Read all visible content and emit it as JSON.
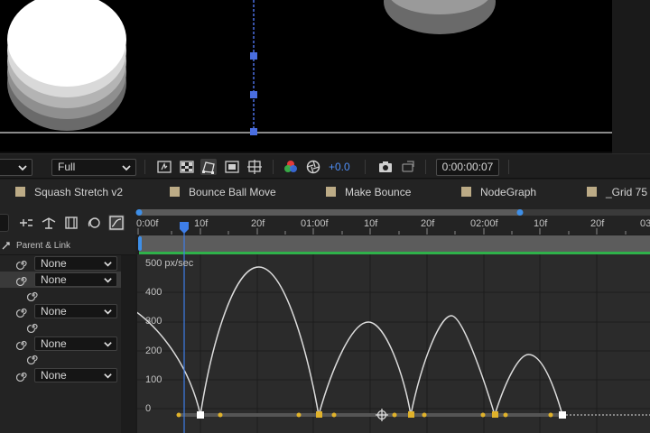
{
  "toolbar": {
    "resolution": "Full",
    "exposure": "+0.0",
    "timecode": "0:00:00:07"
  },
  "tabs": [
    {
      "label": "Squash Stretch v2"
    },
    {
      "label": "Bounce Ball Move"
    },
    {
      "label": "Make Bounce"
    },
    {
      "label": "NodeGraph"
    },
    {
      "label": "_Grid 75"
    }
  ],
  "timeline": {
    "header_label": "Parent & Link",
    "parent_rows": [
      {
        "value": "None"
      },
      {
        "value": "None"
      },
      {
        "value": "None"
      },
      {
        "value": "None"
      },
      {
        "value": "None"
      }
    ],
    "ruler_labels": [
      "0:00f",
      "10f",
      "20f",
      "01:00f",
      "10f",
      "20f",
      "02:00f",
      "10f",
      "20f",
      "03"
    ],
    "graph_unit_label": "500 px/sec",
    "y_labels": [
      "400",
      "300",
      "200",
      "100",
      "0"
    ]
  },
  "colors": {
    "accent_blue": "#4f8ff7",
    "playhead": "#3e7ee8",
    "keyframe": "#e0b22b",
    "curve": "#dcdcdc",
    "work_area_green": "#2fb14a",
    "tab_swatch": "#bcab86"
  },
  "icons": {
    "toolbar": [
      "snapshot-icon",
      "transparency-grid-icon",
      "mask-path-icon",
      "region-of-interest-icon",
      "guides-icon",
      "color-channels-icon",
      "exposure-reset-icon",
      "camera-icon",
      "show-snapshot-icon"
    ],
    "timeline_tools": [
      "shy-layers-icon",
      "draft-3d-icon",
      "frame-blending-icon",
      "motion-blur-icon",
      "graph-editor-icon"
    ]
  }
}
